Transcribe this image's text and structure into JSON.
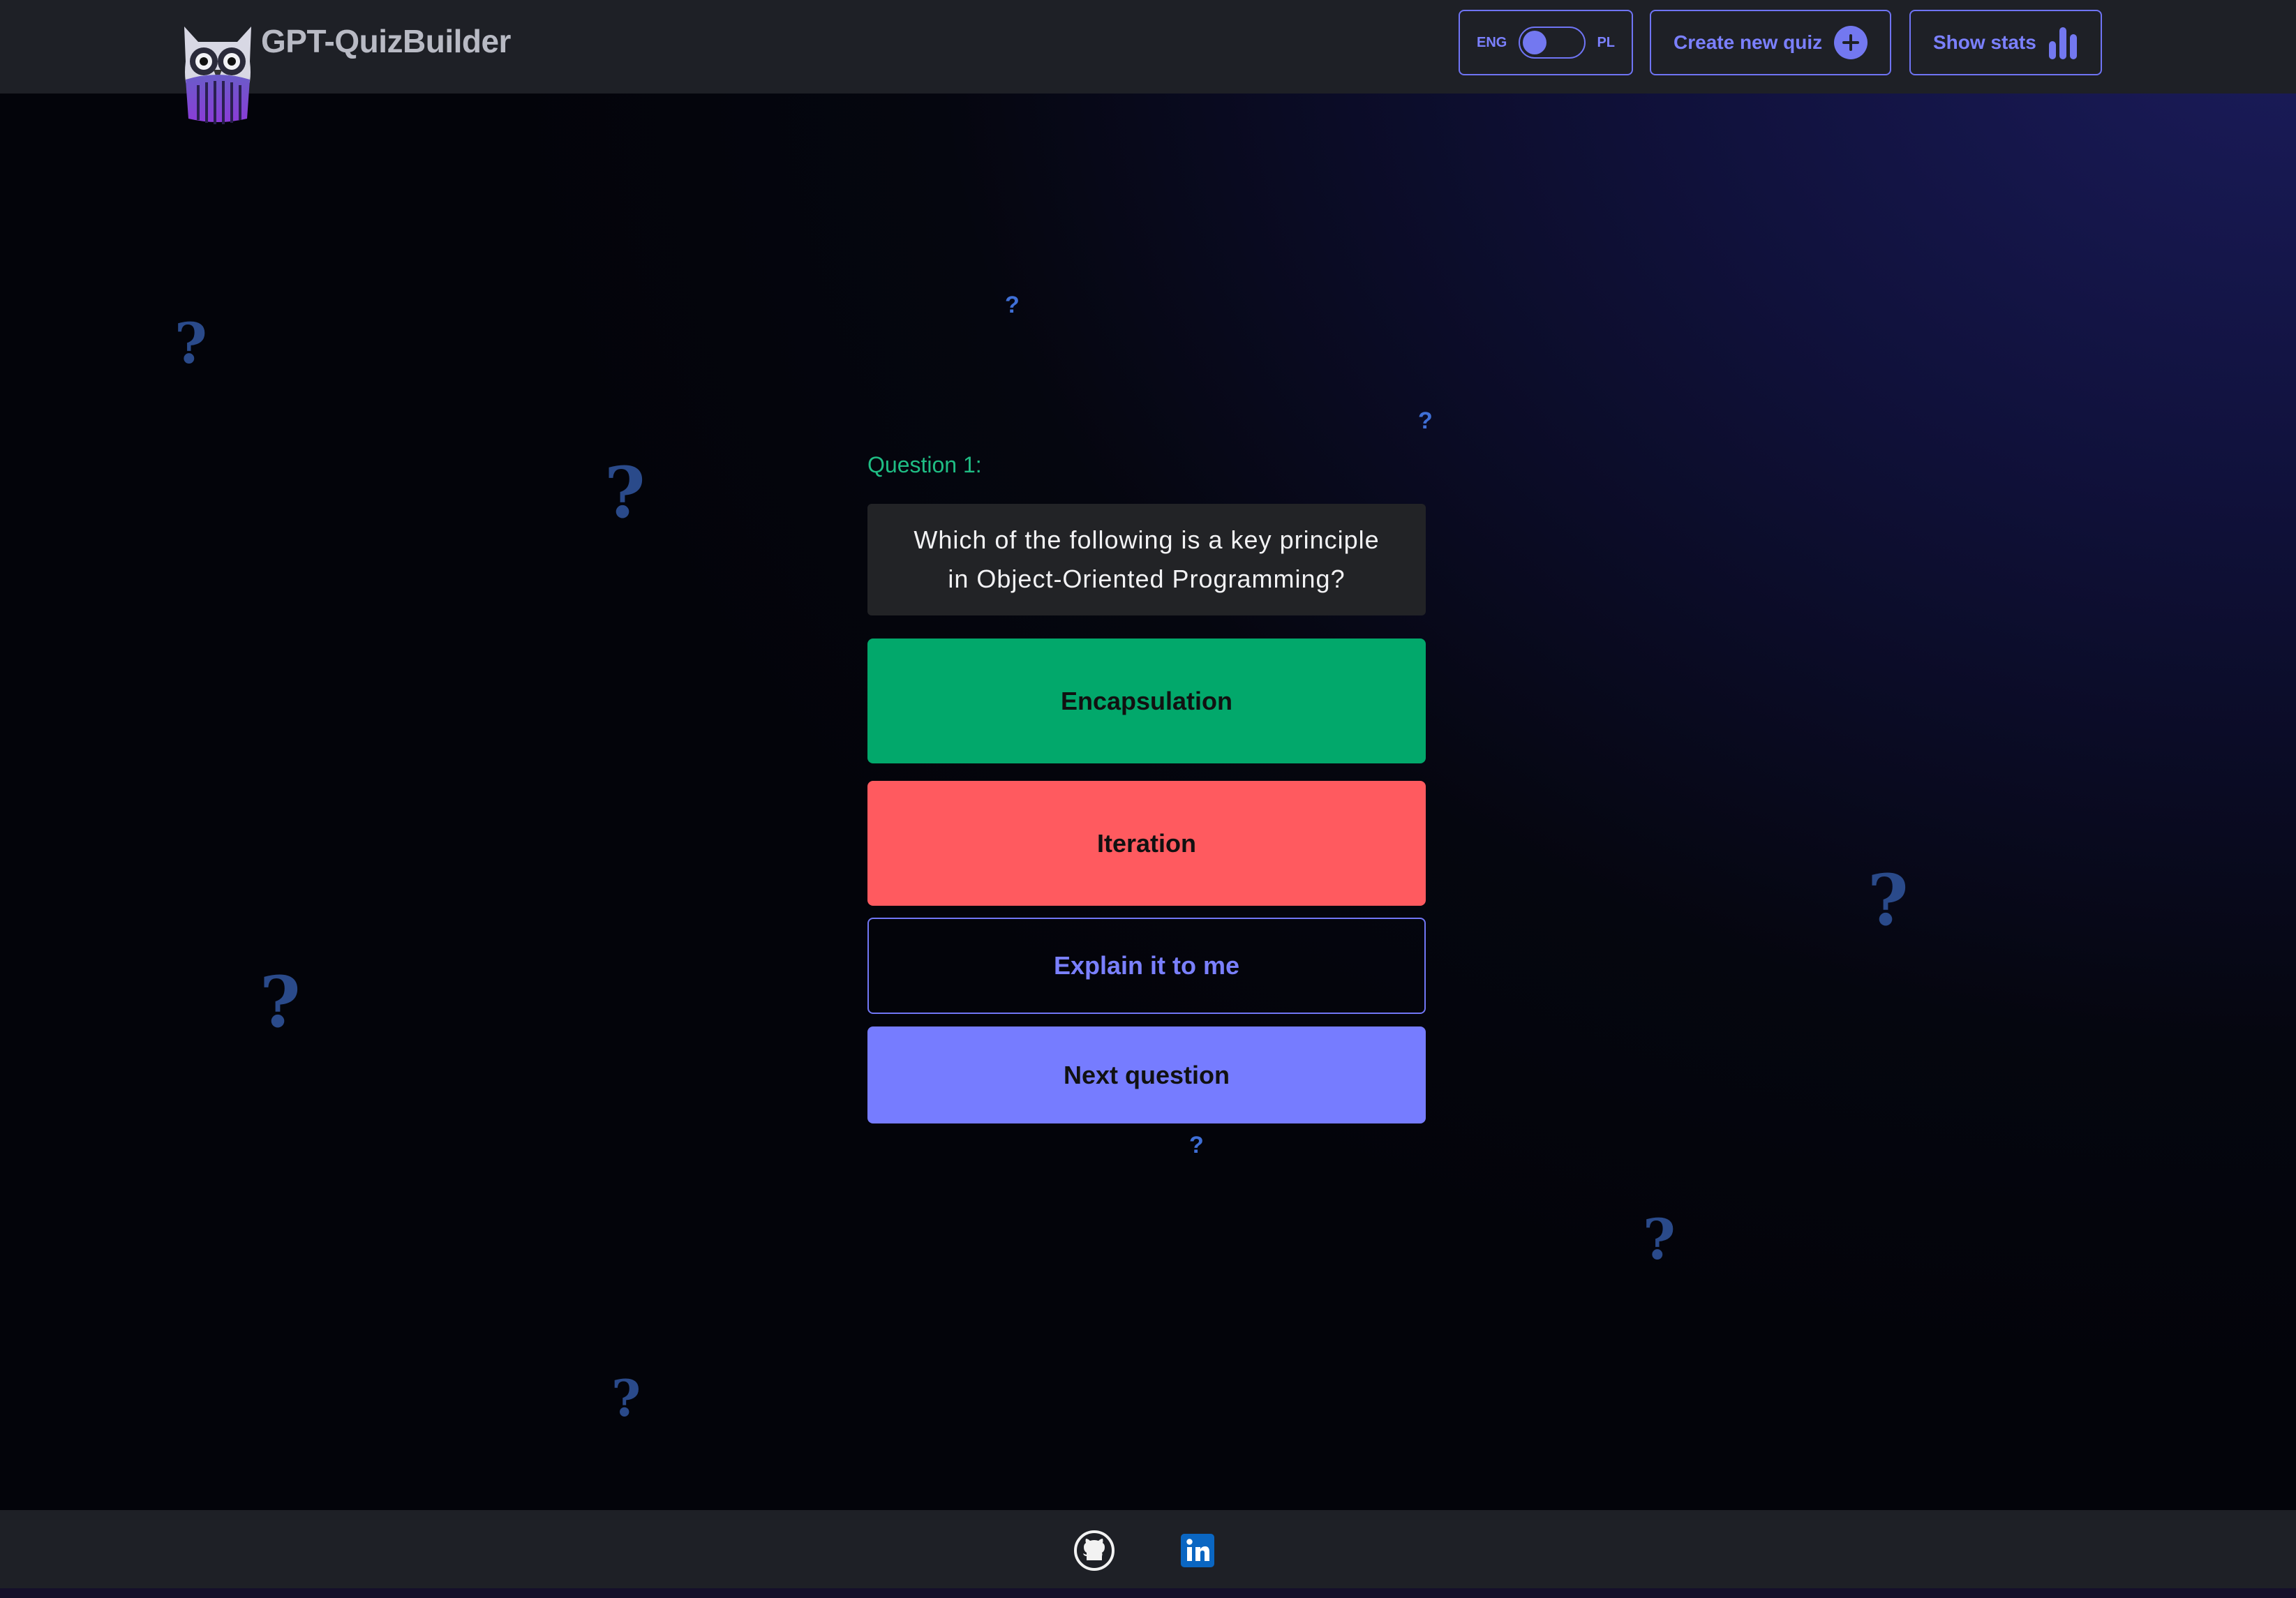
{
  "header": {
    "app_title": "GPT-QuizBuilder",
    "lang_toggle": {
      "left_label": "ENG",
      "right_label": "PL"
    },
    "create_quiz_label": "Create new quiz",
    "show_stats_label": "Show stats"
  },
  "quiz": {
    "question_label": "Question 1:",
    "question_line1": "Which of the following is a key principle",
    "question_line2": "in Object-Oriented Programming?",
    "answers": [
      {
        "label": "Encapsulation",
        "state": "correct"
      },
      {
        "label": "Iteration",
        "state": "wrong"
      }
    ],
    "explain_label": "Explain it to me",
    "next_label": "Next question"
  },
  "decor": {
    "glyph": "?"
  },
  "footer": {
    "icons": [
      "github-icon",
      "linkedin-icon"
    ]
  },
  "colors": {
    "accent": "#767cff",
    "correct": "#02a86b",
    "wrong": "#ff5a5f",
    "question_label": "#1fbd84"
  }
}
